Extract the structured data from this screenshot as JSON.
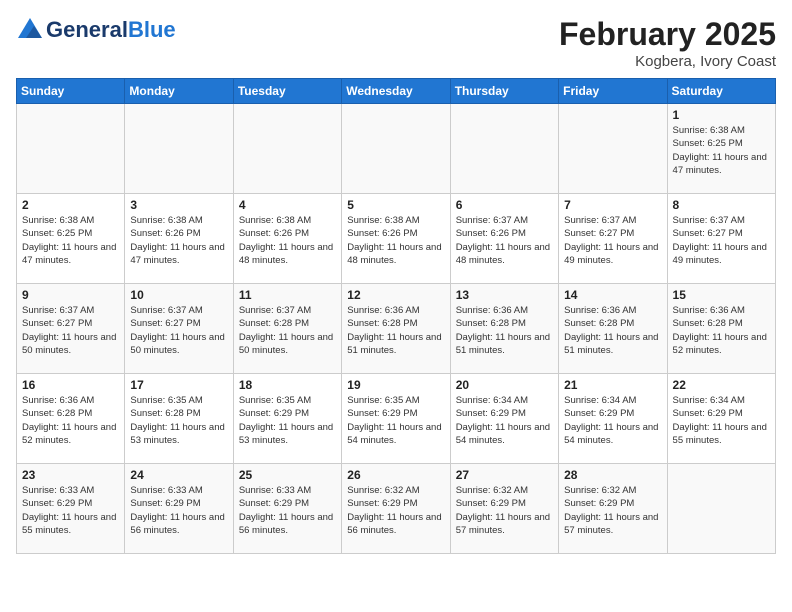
{
  "header": {
    "logo_general": "General",
    "logo_blue": "Blue",
    "main_title": "February 2025",
    "subtitle": "Kogbera, Ivory Coast"
  },
  "weekdays": [
    "Sunday",
    "Monday",
    "Tuesday",
    "Wednesday",
    "Thursday",
    "Friday",
    "Saturday"
  ],
  "weeks": [
    [
      {
        "day": "",
        "info": ""
      },
      {
        "day": "",
        "info": ""
      },
      {
        "day": "",
        "info": ""
      },
      {
        "day": "",
        "info": ""
      },
      {
        "day": "",
        "info": ""
      },
      {
        "day": "",
        "info": ""
      },
      {
        "day": "1",
        "info": "Sunrise: 6:38 AM\nSunset: 6:25 PM\nDaylight: 11 hours\nand 47 minutes."
      }
    ],
    [
      {
        "day": "2",
        "info": "Sunrise: 6:38 AM\nSunset: 6:25 PM\nDaylight: 11 hours\nand 47 minutes."
      },
      {
        "day": "3",
        "info": "Sunrise: 6:38 AM\nSunset: 6:26 PM\nDaylight: 11 hours\nand 47 minutes."
      },
      {
        "day": "4",
        "info": "Sunrise: 6:38 AM\nSunset: 6:26 PM\nDaylight: 11 hours\nand 48 minutes."
      },
      {
        "day": "5",
        "info": "Sunrise: 6:38 AM\nSunset: 6:26 PM\nDaylight: 11 hours\nand 48 minutes."
      },
      {
        "day": "6",
        "info": "Sunrise: 6:37 AM\nSunset: 6:26 PM\nDaylight: 11 hours\nand 48 minutes."
      },
      {
        "day": "7",
        "info": "Sunrise: 6:37 AM\nSunset: 6:27 PM\nDaylight: 11 hours\nand 49 minutes."
      },
      {
        "day": "8",
        "info": "Sunrise: 6:37 AM\nSunset: 6:27 PM\nDaylight: 11 hours\nand 49 minutes."
      }
    ],
    [
      {
        "day": "9",
        "info": "Sunrise: 6:37 AM\nSunset: 6:27 PM\nDaylight: 11 hours\nand 50 minutes."
      },
      {
        "day": "10",
        "info": "Sunrise: 6:37 AM\nSunset: 6:27 PM\nDaylight: 11 hours\nand 50 minutes."
      },
      {
        "day": "11",
        "info": "Sunrise: 6:37 AM\nSunset: 6:28 PM\nDaylight: 11 hours\nand 50 minutes."
      },
      {
        "day": "12",
        "info": "Sunrise: 6:36 AM\nSunset: 6:28 PM\nDaylight: 11 hours\nand 51 minutes."
      },
      {
        "day": "13",
        "info": "Sunrise: 6:36 AM\nSunset: 6:28 PM\nDaylight: 11 hours\nand 51 minutes."
      },
      {
        "day": "14",
        "info": "Sunrise: 6:36 AM\nSunset: 6:28 PM\nDaylight: 11 hours\nand 51 minutes."
      },
      {
        "day": "15",
        "info": "Sunrise: 6:36 AM\nSunset: 6:28 PM\nDaylight: 11 hours\nand 52 minutes."
      }
    ],
    [
      {
        "day": "16",
        "info": "Sunrise: 6:36 AM\nSunset: 6:28 PM\nDaylight: 11 hours\nand 52 minutes."
      },
      {
        "day": "17",
        "info": "Sunrise: 6:35 AM\nSunset: 6:28 PM\nDaylight: 11 hours\nand 53 minutes."
      },
      {
        "day": "18",
        "info": "Sunrise: 6:35 AM\nSunset: 6:29 PM\nDaylight: 11 hours\nand 53 minutes."
      },
      {
        "day": "19",
        "info": "Sunrise: 6:35 AM\nSunset: 6:29 PM\nDaylight: 11 hours\nand 54 minutes."
      },
      {
        "day": "20",
        "info": "Sunrise: 6:34 AM\nSunset: 6:29 PM\nDaylight: 11 hours\nand 54 minutes."
      },
      {
        "day": "21",
        "info": "Sunrise: 6:34 AM\nSunset: 6:29 PM\nDaylight: 11 hours\nand 54 minutes."
      },
      {
        "day": "22",
        "info": "Sunrise: 6:34 AM\nSunset: 6:29 PM\nDaylight: 11 hours\nand 55 minutes."
      }
    ],
    [
      {
        "day": "23",
        "info": "Sunrise: 6:33 AM\nSunset: 6:29 PM\nDaylight: 11 hours\nand 55 minutes."
      },
      {
        "day": "24",
        "info": "Sunrise: 6:33 AM\nSunset: 6:29 PM\nDaylight: 11 hours\nand 56 minutes."
      },
      {
        "day": "25",
        "info": "Sunrise: 6:33 AM\nSunset: 6:29 PM\nDaylight: 11 hours\nand 56 minutes."
      },
      {
        "day": "26",
        "info": "Sunrise: 6:32 AM\nSunset: 6:29 PM\nDaylight: 11 hours\nand 56 minutes."
      },
      {
        "day": "27",
        "info": "Sunrise: 6:32 AM\nSunset: 6:29 PM\nDaylight: 11 hours\nand 57 minutes."
      },
      {
        "day": "28",
        "info": "Sunrise: 6:32 AM\nSunset: 6:29 PM\nDaylight: 11 hours\nand 57 minutes."
      },
      {
        "day": "",
        "info": ""
      }
    ]
  ]
}
